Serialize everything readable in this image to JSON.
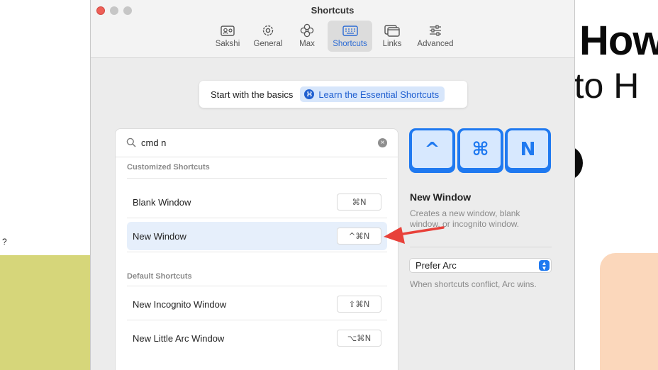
{
  "background": {
    "heading": "How",
    "subheading": "-to H",
    "question_mark": "?"
  },
  "window": {
    "title": "Shortcuts",
    "toolbar": [
      {
        "label": "Sakshi",
        "icon": "profile-card-icon"
      },
      {
        "label": "General",
        "icon": "gear-icon"
      },
      {
        "label": "Max",
        "icon": "max-flower-icon"
      },
      {
        "label": "Shortcuts",
        "icon": "keyboard-icon",
        "active": true
      },
      {
        "label": "Links",
        "icon": "windows-icon"
      },
      {
        "label": "Advanced",
        "icon": "sliders-icon"
      }
    ]
  },
  "banner": {
    "text": "Start with the basics",
    "link_label": "Learn the Essential Shortcuts",
    "link_icon_glyph": "⌘"
  },
  "search": {
    "value": "cmd n",
    "clear_glyph": "×"
  },
  "sections": {
    "customized": {
      "header": "Customized Shortcuts",
      "rows": [
        {
          "name": "Blank Window",
          "keys": "⌘N"
        },
        {
          "name": "New Window",
          "keys": "^⌘N",
          "selected": true
        }
      ]
    },
    "default": {
      "header": "Default Shortcuts",
      "rows": [
        {
          "name": "New Incognito Window",
          "keys": "⇧⌘N"
        },
        {
          "name": "New Little Arc Window",
          "keys": "⌥⌘N"
        }
      ]
    }
  },
  "detail": {
    "keycaps": [
      "^",
      "⌘",
      "N"
    ],
    "title": "New Window",
    "description": "Creates a new window, blank window, or incognito window.",
    "conflict_select": "Prefer Arc",
    "conflict_hint": "When shortcuts conflict, Arc wins."
  },
  "colors": {
    "accent": "#1f79f0",
    "close_button": "#ee5f57",
    "annotation_arrow": "#e8413a",
    "selected_row": "#e6effb"
  }
}
